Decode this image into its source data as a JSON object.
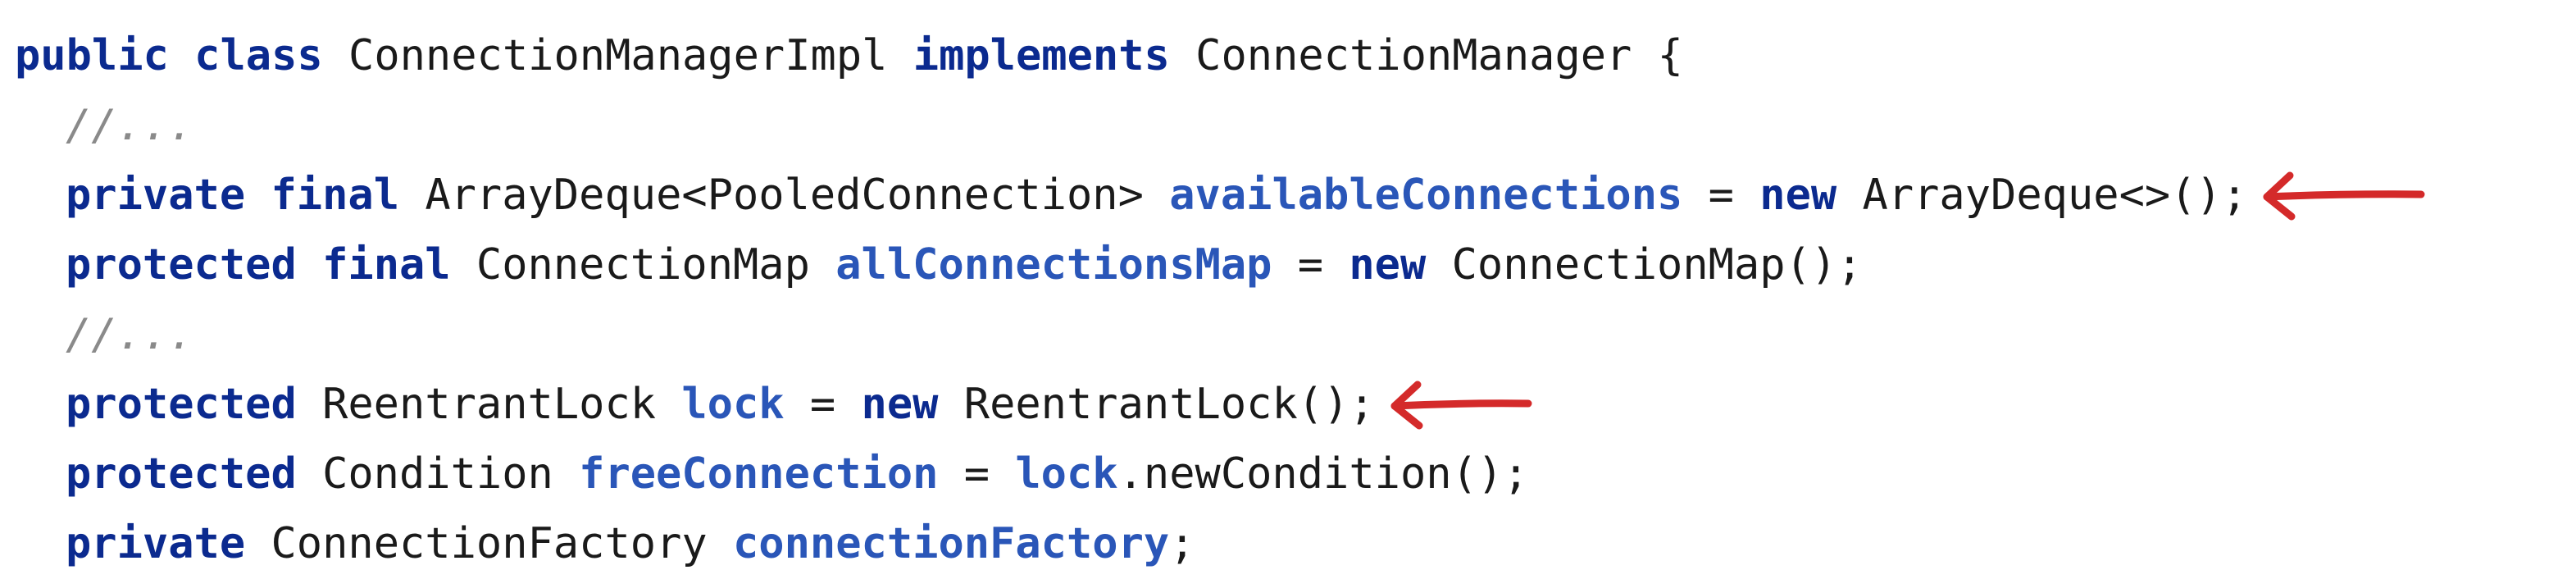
{
  "editor": {
    "lines": [
      {
        "indent": false,
        "tokens": [
          {
            "t": "public",
            "c": "kw"
          },
          {
            "t": " ",
            "c": "txt"
          },
          {
            "t": "class",
            "c": "kw"
          },
          {
            "t": " ConnectionManagerImpl ",
            "c": "txt"
          },
          {
            "t": "implements",
            "c": "kw"
          },
          {
            "t": " ConnectionManager {",
            "c": "txt"
          }
        ]
      },
      {
        "indent": true,
        "tokens": [
          {
            "t": "//...",
            "c": "cm"
          }
        ]
      },
      {
        "indent": true,
        "arrow": true,
        "tokens": [
          {
            "t": "private",
            "c": "kw"
          },
          {
            "t": " ",
            "c": "txt"
          },
          {
            "t": "final",
            "c": "kw"
          },
          {
            "t": " ArrayDeque<PooledConnection> ",
            "c": "txt"
          },
          {
            "t": "availableConnections",
            "c": "fld"
          },
          {
            "t": " = ",
            "c": "txt"
          },
          {
            "t": "new",
            "c": "kw"
          },
          {
            "t": " ArrayDeque<>();",
            "c": "txt"
          }
        ]
      },
      {
        "indent": true,
        "tokens": [
          {
            "t": "protected",
            "c": "kw"
          },
          {
            "t": " ",
            "c": "txt"
          },
          {
            "t": "final",
            "c": "kw"
          },
          {
            "t": " ConnectionMap ",
            "c": "txt"
          },
          {
            "t": "allConnectionsMap",
            "c": "fld"
          },
          {
            "t": " = ",
            "c": "txt"
          },
          {
            "t": "new",
            "c": "kw"
          },
          {
            "t": " ConnectionMap();",
            "c": "txt"
          }
        ]
      },
      {
        "indent": true,
        "tokens": [
          {
            "t": "//...",
            "c": "cm"
          }
        ]
      },
      {
        "indent": true,
        "arrow": true,
        "tokens": [
          {
            "t": "protected",
            "c": "kw"
          },
          {
            "t": " ReentrantLock ",
            "c": "txt"
          },
          {
            "t": "lock",
            "c": "fld"
          },
          {
            "t": " = ",
            "c": "txt"
          },
          {
            "t": "new",
            "c": "kw"
          },
          {
            "t": " ReentrantLock();",
            "c": "txt"
          }
        ]
      },
      {
        "indent": true,
        "tokens": [
          {
            "t": "protected",
            "c": "kw"
          },
          {
            "t": " Condition ",
            "c": "txt"
          },
          {
            "t": "freeConnection",
            "c": "fld"
          },
          {
            "t": " = ",
            "c": "txt"
          },
          {
            "t": "lock",
            "c": "fld"
          },
          {
            "t": ".newCondition();",
            "c": "txt"
          }
        ]
      },
      {
        "indent": true,
        "tokens": [
          {
            "t": "private",
            "c": "kw"
          },
          {
            "t": " ConnectionFactory ",
            "c": "txt"
          },
          {
            "t": "connectionFactory",
            "c": "fld"
          },
          {
            "t": ";",
            "c": "txt"
          }
        ]
      }
    ]
  },
  "annotations": {
    "arrow_color": "#d42a2a",
    "arrow_icon": "red-left-arrow-icon"
  },
  "colors": {
    "keyword": "#0b2a8f",
    "field": "#2a56b8",
    "comment": "#8a8a8a",
    "text": "#1a1a1a",
    "background": "#ffffff"
  }
}
